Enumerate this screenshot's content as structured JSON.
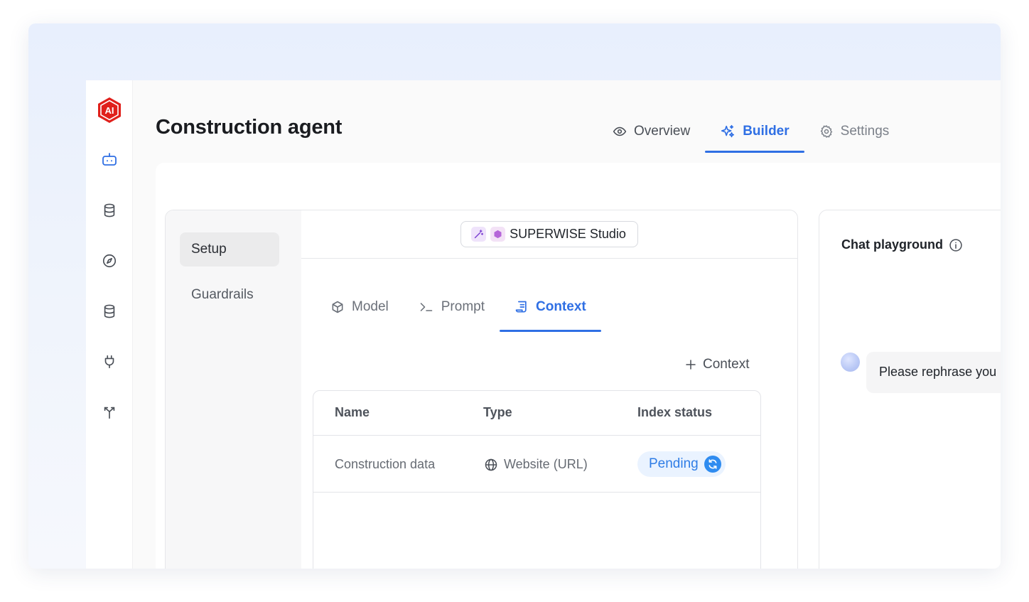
{
  "app": {
    "logo_text": "AI",
    "page_title": "Construction agent",
    "colors": {
      "accent": "#2f6fe4",
      "logo_red": "#e0201b",
      "pending_bg": "#eaf3ff",
      "pending_fg": "#2f7de6"
    }
  },
  "rail": {
    "items": [
      {
        "icon": "bot-icon",
        "active": true
      },
      {
        "icon": "database-icon",
        "active": false
      },
      {
        "icon": "compass-icon",
        "active": false
      },
      {
        "icon": "database-icon",
        "active": false
      },
      {
        "icon": "plug-icon",
        "active": false
      },
      {
        "icon": "fork-icon",
        "active": false
      }
    ]
  },
  "header": {
    "tabs": [
      {
        "label": "Overview",
        "icon": "eye-icon",
        "state": "normal"
      },
      {
        "label": "Builder",
        "icon": "sparkles-icon",
        "state": "active"
      },
      {
        "label": "Settings",
        "icon": "gear-icon",
        "state": "muted"
      }
    ]
  },
  "builder": {
    "side_items": [
      {
        "label": "Setup",
        "active": true
      },
      {
        "label": "Guardrails",
        "active": false
      }
    ],
    "studio_label": "SUPERWISE Studio",
    "sub_tabs": [
      {
        "label": "Model",
        "icon": "cube-icon",
        "active": false
      },
      {
        "label": "Prompt",
        "icon": "terminal-icon",
        "active": false
      },
      {
        "label": "Context",
        "icon": "document-icon",
        "active": true
      }
    ],
    "add_context_label": "Context",
    "table": {
      "headers": [
        "Name",
        "Type",
        "Index status"
      ],
      "rows": [
        {
          "name": "Construction data",
          "type": "Website (URL)",
          "type_icon": "globe-icon",
          "status": "Pending"
        }
      ]
    }
  },
  "chat": {
    "title": "Chat playground",
    "message": "Please rephrase you"
  }
}
